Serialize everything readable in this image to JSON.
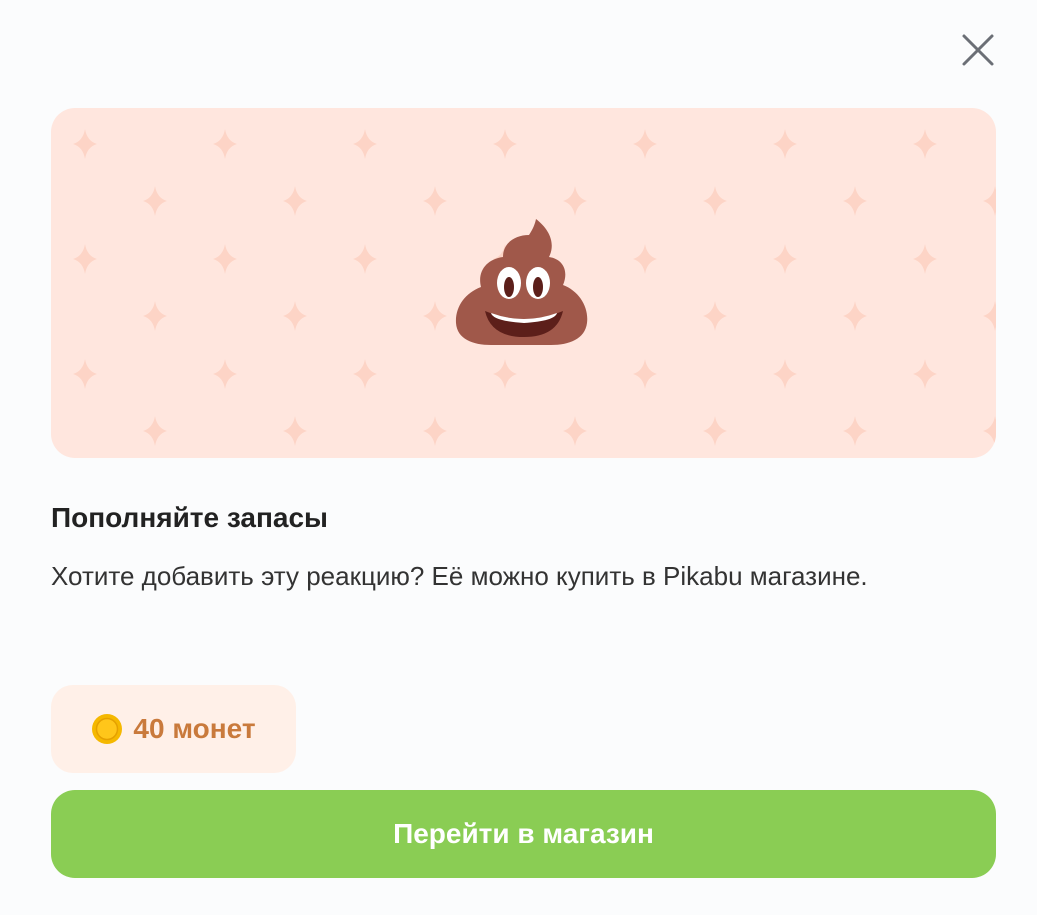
{
  "dialog": {
    "close_icon": "close-icon",
    "banner": {
      "background_color": "#ffe6de",
      "pattern_color": "#fdd4c6",
      "emoji_icon": "pile-of-poo-emoji"
    },
    "title": "Пополняйте запасы",
    "description": "Хотите добавить эту реакцию? Её можно купить в Pikabu магазине.",
    "price": {
      "icon": "coin-icon",
      "label": "40 монет",
      "text_color": "#c97a3c",
      "badge_color": "#fff0e8"
    },
    "action_button": {
      "label": "Перейти в магазин",
      "color": "#8acd54"
    }
  }
}
